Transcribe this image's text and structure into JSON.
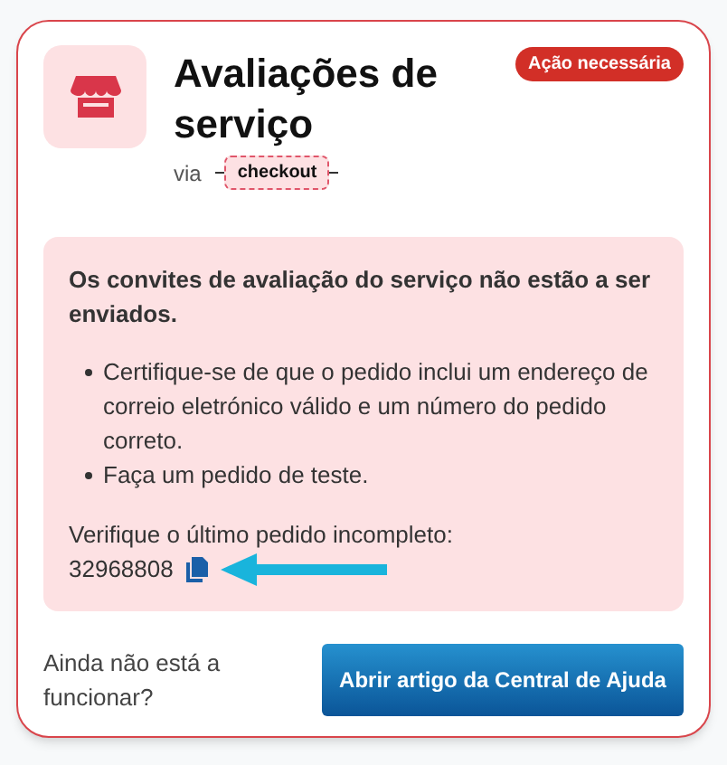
{
  "card": {
    "title": "Avaliações de serviço",
    "badge": "Ação necessária",
    "via_label": "via",
    "source_tag": "checkout"
  },
  "alert": {
    "heading": "Os convites de avaliação do serviço não estão a ser enviados.",
    "bullets": [
      "Certifique-se de que o pedido inclui um endereço de correio eletrónico válido e um número do pedido correto.",
      "Faça um pedido de teste."
    ],
    "check_label": "Verifique o último pedido incompleto:",
    "order_number": "32968808"
  },
  "footer": {
    "question": "Ainda não está a funcionar?",
    "button": "Abrir artigo da Central de Ajuda"
  }
}
